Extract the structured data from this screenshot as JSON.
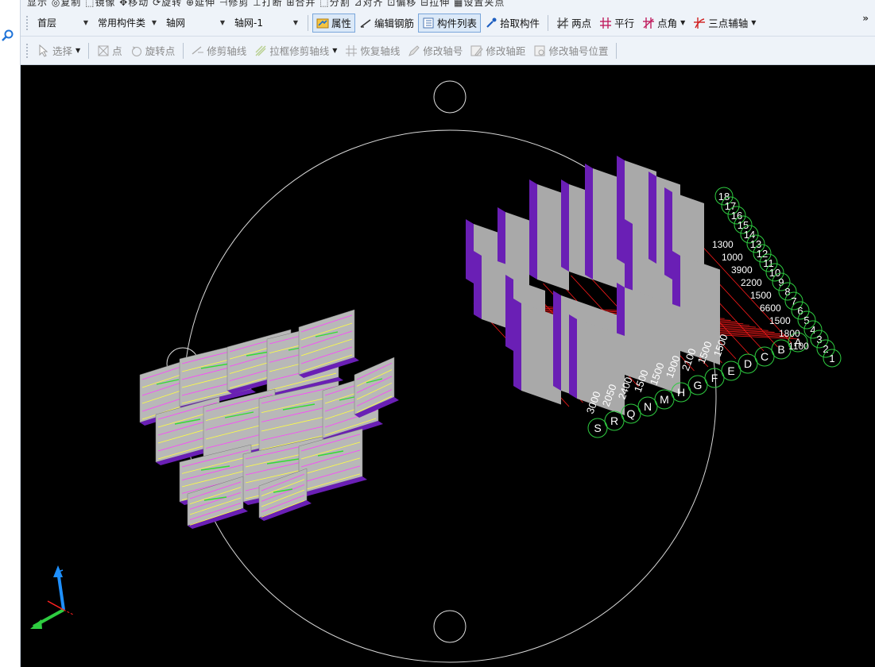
{
  "toolbar_top_cut": {
    "text": "显示  ◎复制  ⬚镜像  ✥移动  ⟳旋转  ⊕延伸  ⊣修剪  ⊥打断  ⊞合并  ⬚分割  ⊿对齐  ⊡偏移  ⊟拉伸  ▦设置夹点"
  },
  "toolbar1": {
    "floor": "首层",
    "category": "常用构件类",
    "type": "轴网",
    "instance": "轴网-1",
    "btn_properties": "属性",
    "btn_edit_rebar": "编辑钢筋",
    "btn_component_list": "构件列表",
    "btn_pick_component": "拾取构件",
    "btn_two_point": "两点",
    "btn_parallel": "平行",
    "btn_point_angle": "点角",
    "btn_three_point_axis": "三点辅轴",
    "more": "»"
  },
  "toolbar2": {
    "select": "选择",
    "point": "点",
    "rotate_point": "旋转点",
    "trim_axis": "修剪轴线",
    "box_trim_axis": "拉框修剪轴线",
    "restore_axis": "恢复轴线",
    "modify_axis_number": "修改轴号",
    "modify_axis_distance": "修改轴距",
    "modify_axis_number_position": "修改轴号位置"
  },
  "viewport": {
    "axis_labels_row": [
      "S",
      "R",
      "Q",
      "N",
      "M",
      "H",
      "G",
      "F",
      "E",
      "D",
      "C",
      "B",
      "A"
    ],
    "axis_labels_col": [
      "18",
      "17",
      "16",
      "15",
      "14",
      "13",
      "12",
      "11",
      "10",
      "9",
      "8",
      "7",
      "6",
      "5",
      "4",
      "3",
      "2",
      "1"
    ],
    "dimension_texts": [
      "3000",
      "2050",
      "2400",
      "1500",
      "1500",
      "1900",
      "2100",
      "1500",
      "1500",
      "1300",
      "1000",
      "3900",
      "2200",
      "1500",
      "6600",
      "1500",
      "1800",
      "1100"
    ],
    "colors": {
      "background": "#000000",
      "wall": "#a9a9a9",
      "wall_side": "#6a1fb5",
      "grid": "#ff1a1a",
      "bubble": "#2ecc40",
      "text": "#ffffff",
      "orbit": "#ffffff"
    }
  }
}
